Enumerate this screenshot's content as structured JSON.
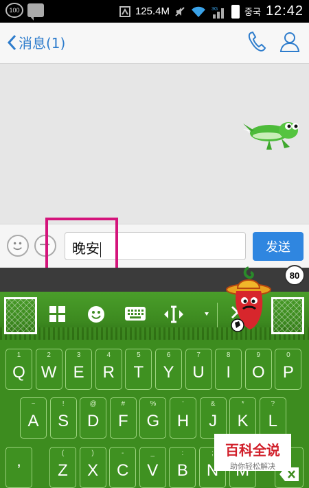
{
  "statusbar": {
    "notification_badge": "100",
    "net_speed": "125.4M",
    "carrier": "중국",
    "time": "12:42",
    "signal_label": "3G"
  },
  "header": {
    "back_label": "消息(1)"
  },
  "chat": {
    "sticker": "green-lizard-sticker"
  },
  "composer": {
    "input_value": "晚安",
    "send_label": "发送"
  },
  "keyboard": {
    "badge": "80",
    "toolbar_icons": [
      "grid-icon",
      "emoji-icon",
      "keyboard-icon",
      "cursor-move-icon",
      "dropdown-icon",
      "close-icon"
    ],
    "row1": [
      {
        "alt": "1",
        "main": "Q"
      },
      {
        "alt": "2",
        "main": "W"
      },
      {
        "alt": "3",
        "main": "E"
      },
      {
        "alt": "4",
        "main": "R"
      },
      {
        "alt": "5",
        "main": "T"
      },
      {
        "alt": "6",
        "main": "Y"
      },
      {
        "alt": "7",
        "main": "U"
      },
      {
        "alt": "8",
        "main": "I"
      },
      {
        "alt": "9",
        "main": "O"
      },
      {
        "alt": "0",
        "main": "P"
      }
    ],
    "row2": [
      {
        "alt": "~",
        "main": "A"
      },
      {
        "alt": "!",
        "main": "S"
      },
      {
        "alt": "@",
        "main": "D"
      },
      {
        "alt": "#",
        "main": "F"
      },
      {
        "alt": "%",
        "main": "G"
      },
      {
        "alt": "'",
        "main": "H"
      },
      {
        "alt": "&",
        "main": "J"
      },
      {
        "alt": "*",
        "main": "K"
      },
      {
        "alt": "?",
        "main": "L"
      }
    ],
    "row3": [
      {
        "alt": "",
        "main": "’"
      },
      {
        "alt": "(",
        "main": "Z"
      },
      {
        "alt": ")",
        "main": "X"
      },
      {
        "alt": "-",
        "main": "C"
      },
      {
        "alt": "_",
        "main": "V"
      },
      {
        "alt": ":",
        "main": "B"
      },
      {
        "alt": ";",
        "main": "N"
      },
      {
        "alt": "/",
        "main": "M"
      }
    ]
  },
  "watermark": {
    "title": "百科全说",
    "subtitle": "助你轻松解决"
  },
  "colors": {
    "accent_blue": "#2f86e0",
    "highlight_pink": "#d4147b",
    "keyboard_green": "#3d8c1f"
  }
}
